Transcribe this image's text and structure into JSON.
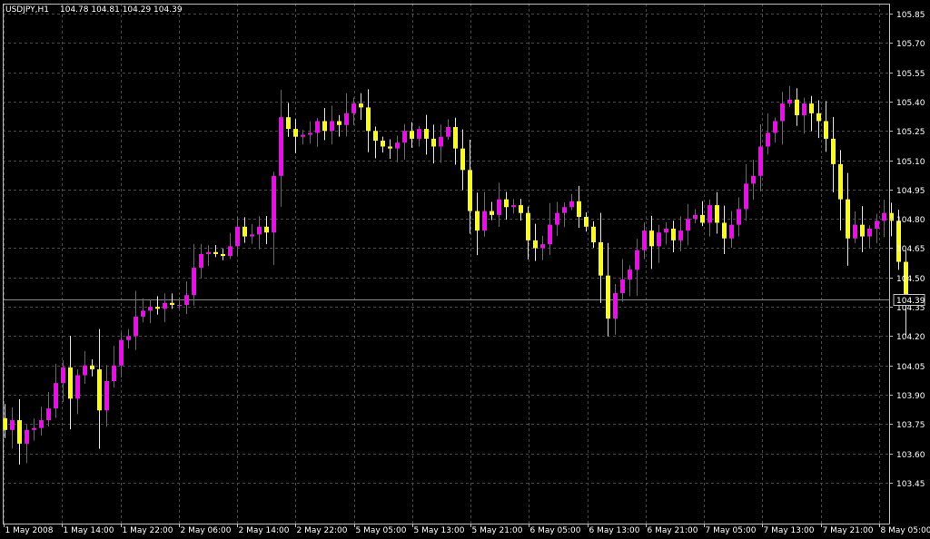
{
  "header": {
    "symbol": "USDJPY,H1",
    "ohlc": "104.78 104.81 104.29 104.39"
  },
  "colors": {
    "background": "#000000",
    "grid": "#4a4a4a",
    "axis": "#c0c0c0",
    "text": "#ffffff",
    "bull": "#ff00ff",
    "bear": "#ffff00",
    "price_line": "#8c8c8c"
  },
  "chart_data": {
    "type": "candlestick",
    "title": "USDJPY,H1",
    "ylim": [
      103.37,
      105.8
    ],
    "y_ticks": [
      105.85,
      105.7,
      105.55,
      105.4,
      105.25,
      105.1,
      104.95,
      104.8,
      104.65,
      104.5,
      104.35,
      104.2,
      104.05,
      103.9,
      103.75,
      103.6,
      103.45
    ],
    "y_tick_labels": [
      "105.85",
      "105.70",
      "105.55",
      "105.40",
      "105.25",
      "105.10",
      "104.95",
      "104.80",
      "104.65",
      "104.50",
      "104.35",
      "104.20",
      "104.05",
      "103.90",
      "103.75",
      "103.60",
      "103.45"
    ],
    "x_labels": [
      "1 May 2008",
      "1 May 14:00",
      "1 May 22:00",
      "2 May 06:00",
      "2 May 14:00",
      "2 May 22:00",
      "5 May 05:00",
      "5 May 13:00",
      "5 May 21:00",
      "6 May 05:00",
      "6 May 13:00",
      "6 May 21:00",
      "7 May 05:00",
      "7 May 13:00",
      "7 May 21:00",
      "8 May 05:00"
    ],
    "current_price": 104.39,
    "current_price_label": "104.39",
    "grid": true,
    "closes": [
      103.72,
      103.77,
      103.65,
      103.72,
      103.73,
      103.77,
      103.83,
      103.96,
      104.04,
      103.88,
      104.0,
      104.05,
      104.03,
      103.82,
      103.97,
      104.05,
      104.18,
      104.2,
      104.3,
      104.33,
      104.35,
      104.34,
      104.37,
      104.36,
      104.36,
      104.41,
      104.55,
      104.62,
      104.63,
      104.62,
      104.61,
      104.66,
      104.76,
      104.71,
      104.72,
      104.76,
      104.73,
      105.02,
      105.32,
      105.26,
      105.22,
      105.23,
      105.24,
      105.3,
      105.25,
      105.3,
      105.28,
      105.34,
      105.39,
      105.37,
      105.25,
      105.2,
      105.17,
      105.16,
      105.19,
      105.25,
      105.21,
      105.26,
      105.21,
      105.17,
      105.22,
      105.27,
      105.16,
      105.05,
      104.84,
      104.74,
      104.84,
      104.82,
      104.9,
      104.86,
      104.87,
      104.83,
      104.69,
      104.65,
      104.67,
      104.77,
      104.83,
      104.86,
      104.89,
      104.81,
      104.76,
      104.68,
      104.51,
      104.29,
      104.42,
      104.49,
      104.54,
      104.64,
      104.74,
      104.66,
      104.73,
      104.75,
      104.69,
      104.74,
      104.8,
      104.82,
      104.78,
      104.87,
      104.78,
      104.7,
      104.77,
      104.85,
      104.98,
      105.02,
      105.17,
      105.24,
      105.3,
      105.39,
      105.41,
      105.33,
      105.39,
      105.34,
      105.3,
      105.21,
      105.08,
      104.9,
      104.7,
      104.77,
      104.71,
      104.75,
      104.79,
      104.83,
      104.79,
      104.58,
      104.39
    ]
  }
}
